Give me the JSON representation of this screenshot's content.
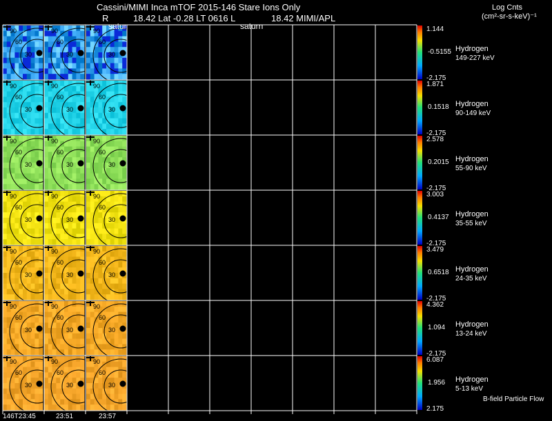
{
  "header": {
    "title": "Cassini/MIMI Inca mTOF  2015-146   Stare   Ions Only",
    "line2_r": "R",
    "line2_coords": "18.42 Lat -0.28 LT 0616 L",
    "line2_l": "18.42  MIMI/APL",
    "satur_label": "satur",
    "saturn_label": "saturn"
  },
  "units": {
    "line1": "Log Cnts",
    "line2": "(cm²-sr-s-keV)⁻¹"
  },
  "footer": {
    "times": [
      "146T23:45",
      "23:51",
      "23:57"
    ],
    "bfield_label": "B-field Particle Flow"
  },
  "chart_data": {
    "type": "heatmap",
    "title": "Cassini/MIMI Inca mTOF  2015-146   Stare   Ions Only",
    "colorbar_label": "Log Cnts (cm²-sr-s-keV)⁻¹",
    "columns": [
      "146T23:45",
      "23:51",
      "23:57"
    ],
    "contour_labels": [
      "30",
      "60",
      "90"
    ],
    "rows": [
      {
        "species": "Hydrogen",
        "energy": "149-227 keV",
        "cmax": "1.144",
        "cmid": "-0.5155",
        "cmin": "-2.175",
        "base_color": "#3aa6f2"
      },
      {
        "species": "Hydrogen",
        "energy": "90-149 keV",
        "cmax": "1.871",
        "cmid": "0.1518",
        "cmin": "-2.175",
        "base_color": "#22d3e8"
      },
      {
        "species": "Hydrogen",
        "energy": "55-90 keV",
        "cmax": "2.578",
        "cmid": "0.2015",
        "cmin": "-2.175",
        "base_color": "#8fe05a"
      },
      {
        "species": "Hydrogen",
        "energy": "35-55 keV",
        "cmax": "3.003",
        "cmid": "0.4137",
        "cmin": "-2.175",
        "base_color": "#f2e212"
      },
      {
        "species": "Hydrogen",
        "energy": "24-35 keV",
        "cmax": "3.479",
        "cmid": "0.6518",
        "cmin": "-2.175",
        "base_color": "#f5b81c"
      },
      {
        "species": "Hydrogen",
        "energy": "13-24 keV",
        "cmax": "4.362",
        "cmid": "1.094",
        "cmin": "-2.175",
        "base_color": "#f5a826"
      },
      {
        "species": "Hydrogen",
        "energy": "5-13 keV",
        "cmax": "6.087",
        "cmid": "1.956",
        "cmin": "2.175",
        "base_color": "#f5a52a"
      }
    ]
  }
}
